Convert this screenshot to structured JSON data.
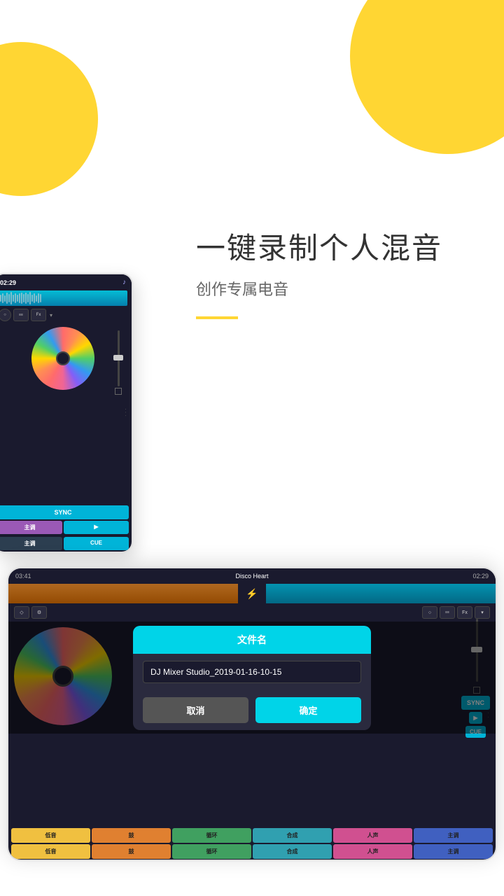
{
  "background": "#ffffff",
  "blobs": {
    "color": "#FFD633"
  },
  "text_section": {
    "main_title": "一键录制个人混音",
    "sub_title": "创作专属电音",
    "yellow_line": true
  },
  "tablet_top": {
    "time": "02:29",
    "controls": {
      "circle": "○",
      "eq": "≡≡≡",
      "fx": "Fx"
    },
    "buttons": {
      "sync": "SYNC",
      "zhu_1": "主调",
      "play": "▶",
      "zhu_2": "主调",
      "cue": "CUE"
    },
    "handle": "···"
  },
  "tablet_bottom": {
    "time_left": "03:41",
    "song_name": "Disco Heart",
    "time_right": "02:29",
    "controls_left": {
      "diamond": "◇",
      "gear": "⚙"
    },
    "controls_right": {
      "circle": "○",
      "eq": "≡≡≡",
      "fx": "Fx"
    },
    "dialog": {
      "title": "文件名",
      "input_value": "DJ Mixer Studio_2019-01-16-10-15",
      "cancel": "取消",
      "confirm": "确定"
    },
    "buttons_right": {
      "sync": "SYNC",
      "play": "▶",
      "cue": "CUE"
    },
    "pad_rows": [
      [
        "低音",
        "鼓",
        "循环",
        "合成",
        "人声",
        "主调"
      ],
      [
        "低音",
        "鼓",
        "循环",
        "合成",
        "人声",
        "主调"
      ]
    ]
  }
}
